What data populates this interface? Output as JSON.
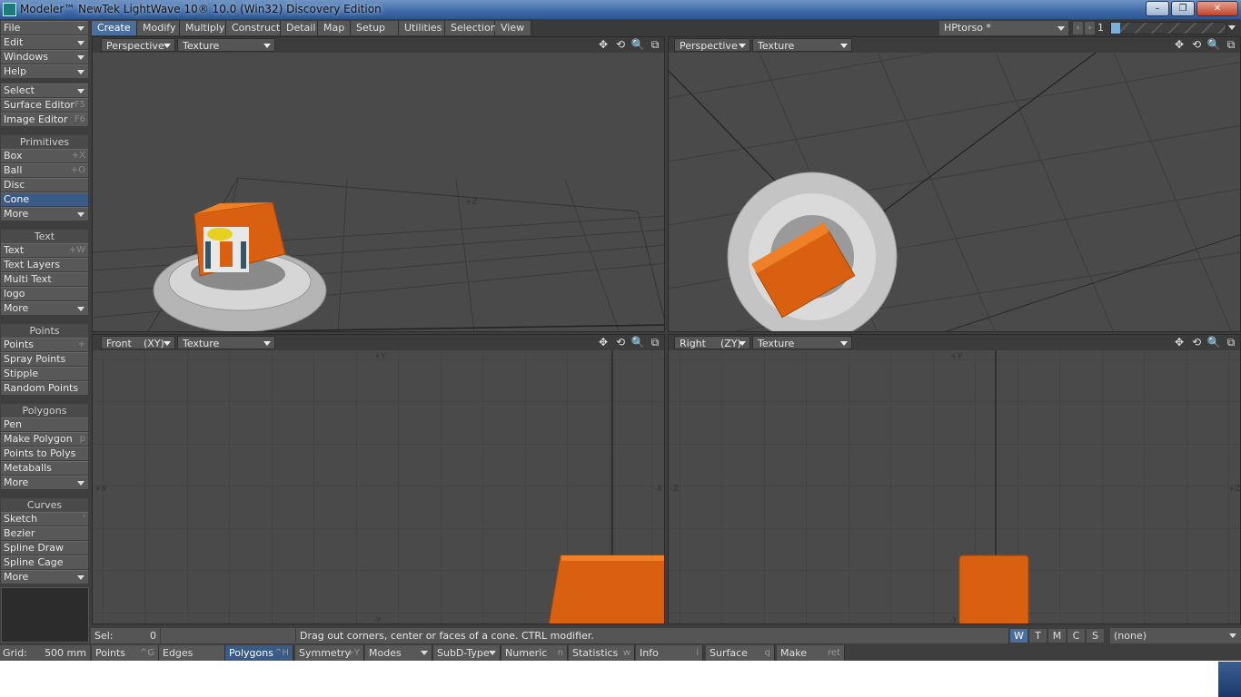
{
  "window": {
    "title": "Modeler™ NewTek LightWave 10® 10.0 (Win32) Discovery Edition",
    "min": "–",
    "max": "❐",
    "close": "✕"
  },
  "sidebar": {
    "top": [
      {
        "label": "File"
      },
      {
        "label": "Edit"
      },
      {
        "label": "Windows"
      },
      {
        "label": "Help"
      }
    ],
    "general": [
      {
        "label": "Select",
        "shortcut": ""
      },
      {
        "label": "Surface Editor",
        "shortcut": "F5"
      },
      {
        "label": "Image Editor",
        "shortcut": "F6"
      }
    ],
    "primitives": {
      "heading": "Primitives",
      "items": [
        {
          "label": "Box",
          "shortcut": "+X"
        },
        {
          "label": "Ball",
          "shortcut": "+O"
        },
        {
          "label": "Disc",
          "shortcut": ""
        },
        {
          "label": "Cone",
          "shortcut": ""
        },
        {
          "label": "More",
          "shortcut": ""
        }
      ]
    },
    "text": {
      "heading": "Text",
      "items": [
        {
          "label": "Text",
          "shortcut": "+W"
        },
        {
          "label": "Text Layers",
          "shortcut": ""
        },
        {
          "label": "Multi Text",
          "shortcut": ""
        },
        {
          "label": "logo",
          "shortcut": ""
        },
        {
          "label": "More",
          "shortcut": ""
        }
      ]
    },
    "points": {
      "heading": "Points",
      "items": [
        {
          "label": "Points",
          "shortcut": "+"
        },
        {
          "label": "Spray Points",
          "shortcut": ""
        },
        {
          "label": "Stipple",
          "shortcut": ""
        },
        {
          "label": "Random Points",
          "shortcut": ""
        }
      ]
    },
    "polygons": {
      "heading": "Polygons",
      "items": [
        {
          "label": "Pen",
          "shortcut": ""
        },
        {
          "label": "Make Polygon",
          "shortcut": "p"
        },
        {
          "label": "Points to Polys",
          "shortcut": ""
        },
        {
          "label": "Metaballs",
          "shortcut": ""
        },
        {
          "label": "More",
          "shortcut": ""
        }
      ]
    },
    "curves": {
      "heading": "Curves",
      "items": [
        {
          "label": "Sketch",
          "shortcut": "'"
        },
        {
          "label": "Bezier",
          "shortcut": ""
        },
        {
          "label": "Spline Draw",
          "shortcut": ""
        },
        {
          "label": "Spline Cage",
          "shortcut": ""
        },
        {
          "label": "More",
          "shortcut": ""
        }
      ]
    }
  },
  "tabs": [
    {
      "label": "Create"
    },
    {
      "label": "Modify"
    },
    {
      "label": "Multiply"
    },
    {
      "label": "Construct"
    },
    {
      "label": "Detail"
    },
    {
      "label": "Map"
    },
    {
      "label": "Setup"
    },
    {
      "label": "Utilities"
    },
    {
      "label": "Selection"
    },
    {
      "label": "View"
    }
  ],
  "object": {
    "name": "HPtorso *",
    "layer_number": "1",
    "prev": "‹",
    "next": "›"
  },
  "viewports": [
    {
      "view": "Perspective",
      "axis": "",
      "shading": "Texture",
      "axis_label": "+Z"
    },
    {
      "view": "Perspective",
      "axis": "",
      "shading": "Texture",
      "axis_label": ""
    },
    {
      "view": "Front",
      "axis": "(XY)",
      "shading": "Texture",
      "labels": {
        "top": "+Y",
        "bottom": "-Y",
        "left": "+X",
        "right": "-X"
      }
    },
    {
      "view": "Right",
      "axis": "(ZY)",
      "shading": "Texture",
      "labels": {
        "top": "+Y",
        "bottom": "-Y",
        "left": "-Z",
        "right": "+Z"
      }
    }
  ],
  "vp_icons": [
    "✥",
    "⟲",
    "🔍",
    "⧉"
  ],
  "status": {
    "sel_label": "Sel:",
    "sel_value": "0",
    "hint": "Drag out corners, center or faces of a cone. CTRL modifier.",
    "wtm": [
      "W",
      "T",
      "M",
      "C",
      "S"
    ],
    "surface": "(none)"
  },
  "bottom": {
    "grid_label": "Grid:",
    "grid_value": "500 mm",
    "items": [
      {
        "label": "Points",
        "shortcut": "^G"
      },
      {
        "label": "Edges",
        "shortcut": ""
      },
      {
        "label": "Polygons",
        "shortcut": "^H"
      },
      {
        "label": "Symmetry",
        "shortcut": "+Y"
      },
      {
        "label": "Modes",
        "shortcut": ""
      },
      {
        "label": "SubD-Type",
        "shortcut": ""
      },
      {
        "label": "Numeric",
        "shortcut": "n"
      },
      {
        "label": "Statistics",
        "shortcut": "w"
      },
      {
        "label": "Info",
        "shortcut": "i"
      },
      {
        "label": "Surface",
        "shortcut": "q"
      },
      {
        "label": "Make",
        "shortcut": "ret"
      }
    ]
  },
  "colors": {
    "accent": "#4a6e9e",
    "orange": "#d96010",
    "viewport_bg": "#4a4a4a"
  }
}
